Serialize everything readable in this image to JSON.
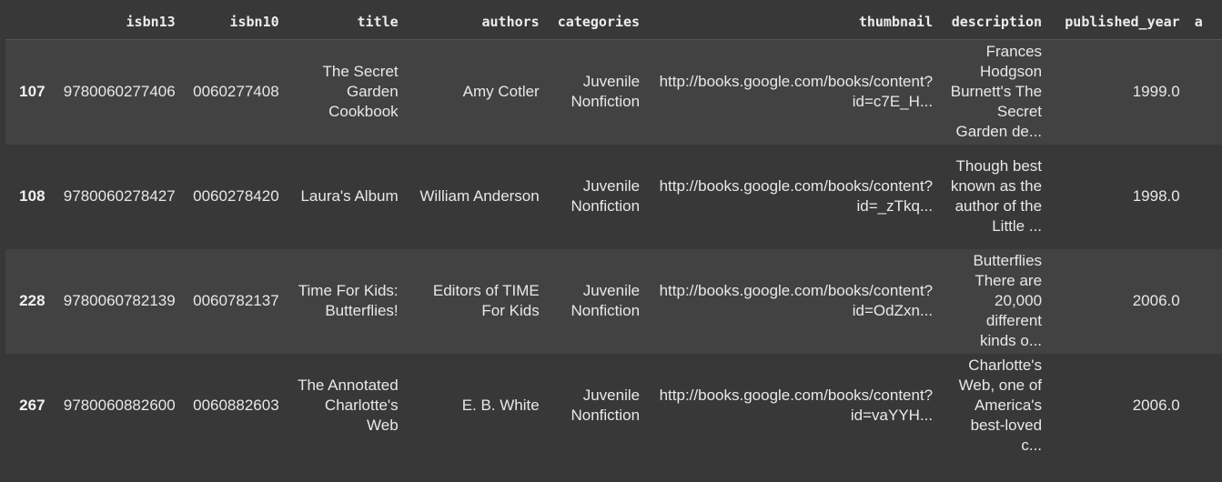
{
  "columns": [
    "",
    "isbn13",
    "isbn10",
    "title",
    "authors",
    "categories",
    "thumbnail",
    "description",
    "published_year",
    "a"
  ],
  "rows": [
    {
      "index": "107",
      "isbn13": "9780060277406",
      "isbn10": "0060277408",
      "title": "The Secret Garden Cookbook",
      "authors": "Amy Cotler",
      "categories": "Juvenile Nonfiction",
      "thumbnail": "http://books.google.com/books/content?id=c7E_H...",
      "description": "Frances Hodgson Burnett's The Secret Garden de...",
      "published_year": "1999.0"
    },
    {
      "index": "108",
      "isbn13": "9780060278427",
      "isbn10": "0060278420",
      "title": "Laura's Album",
      "authors": "William Anderson",
      "categories": "Juvenile Nonfiction",
      "thumbnail": "http://books.google.com/books/content?id=_zTkq...",
      "description": "Though best known as the author of the Little ...",
      "published_year": "1998.0"
    },
    {
      "index": "228",
      "isbn13": "9780060782139",
      "isbn10": "0060782137",
      "title": "Time For Kids: Butterflies!",
      "authors": "Editors of TIME For Kids",
      "categories": "Juvenile Nonfiction",
      "thumbnail": "http://books.google.com/books/content?id=OdZxn...",
      "description": "Butterflies There are 20,000 different kinds o...",
      "published_year": "2006.0"
    },
    {
      "index": "267",
      "isbn13": "9780060882600",
      "isbn10": "0060882603",
      "title": "The Annotated Charlotte's Web",
      "authors": "E. B. White",
      "categories": "Juvenile Nonfiction",
      "thumbnail": "http://books.google.com/books/content?id=vaYYH...",
      "description": "Charlotte's Web, one of America's best-loved c...",
      "published_year": "2006.0"
    }
  ]
}
